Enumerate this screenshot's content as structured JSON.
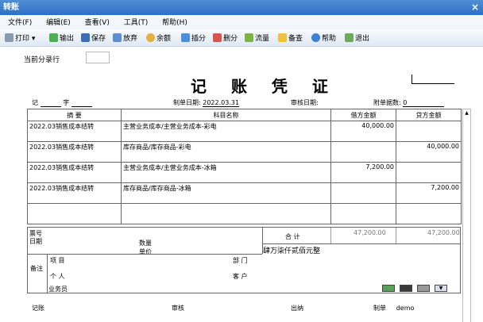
{
  "window": {
    "title": "转账",
    "close": "×"
  },
  "menu": [
    "文件(F)",
    "编辑(E)",
    "查看(V)",
    "工具(T)",
    "帮助(H)"
  ],
  "toolbar": {
    "print": "打印",
    "export": "输出",
    "save": "保存",
    "discard": "放弃",
    "balance": "余额",
    "insert": "插分",
    "delete": "删分",
    "flow": "流量",
    "check": "备查",
    "help": "帮助",
    "exit": "退出"
  },
  "entry_row": {
    "label": "当前分录行"
  },
  "voucher": {
    "title": "记 账 凭 证",
    "type_label": "记",
    "no_label": "字",
    "date_label": "制单日期:",
    "date": "2022.03.31",
    "audit_date_label": "审核日期:",
    "attach_label": "附单据数:",
    "attach_count": "0",
    "headers": {
      "summary": "摘 要",
      "account": "科目名称",
      "debit": "借方金额",
      "credit": "贷方金额"
    },
    "rows": [
      {
        "summary": "2022.03销售成本结转",
        "account": "主营业务成本/主营业务成本-彩电",
        "debit": "40,000.00",
        "credit": ""
      },
      {
        "summary": "2022.03销售成本结转",
        "account": "库存商品/库存商品-彩电",
        "debit": "",
        "credit": "40,000.00"
      },
      {
        "summary": "2022.03销售成本结转",
        "account": "主营业务成本/主营业务成本-冰箱",
        "debit": "7,200.00",
        "credit": ""
      },
      {
        "summary": "2022.03销售成本结转",
        "account": "库存商品/库存商品-冰箱",
        "debit": "",
        "credit": "7,200.00"
      }
    ],
    "ticket_no": "票号",
    "ticket_date": "日期",
    "qty": "数量",
    "price": "单价",
    "total_label": "合 计",
    "total_debit": "47,200.00",
    "total_credit": "47,200.00",
    "total_words": "肆万柒仟贰佰元整",
    "note_label": "备注",
    "project": "项 目",
    "dept": "部 门",
    "person": "个 人",
    "customer": "客 户",
    "salesman": "业务员"
  },
  "footer": {
    "bookkeeper": "记账",
    "audit": "审核",
    "cashier": "出纳",
    "maker": "制单",
    "maker_name": "demo"
  }
}
